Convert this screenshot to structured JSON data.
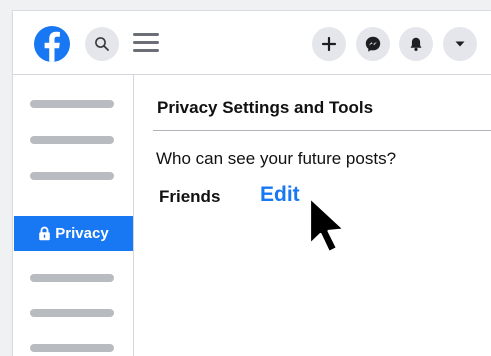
{
  "header": {
    "logo_icon": "facebook-logo-icon",
    "left_icons": [
      "search-icon",
      "hamburger-menu-icon"
    ],
    "right_icons": [
      "plus-icon",
      "messenger-icon",
      "bell-icon",
      "caret-down-icon"
    ]
  },
  "sidebar": {
    "active_item": {
      "icon": "lock-icon",
      "label": "Privacy"
    },
    "accent_color": "#1877f2"
  },
  "content": {
    "title": "Privacy Settings and Tools",
    "question": "Who can see your future posts?",
    "audience": "Friends",
    "edit_label": "Edit",
    "link_color": "#1877f2"
  },
  "cursor_icon": "mouse-pointer-icon"
}
